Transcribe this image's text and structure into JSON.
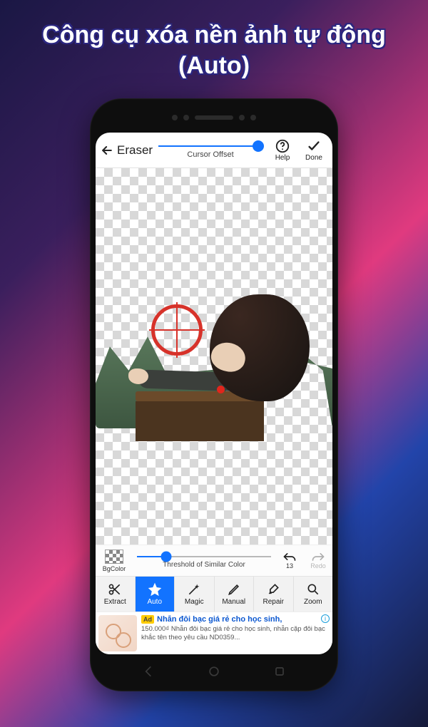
{
  "promo": {
    "title": "Công cụ xóa nền ảnh tự động (Auto)"
  },
  "header": {
    "back_label": "Eraser",
    "cursor_offset_label": "Cursor Offset",
    "help_label": "Help",
    "done_label": "Done"
  },
  "threshold_row": {
    "bgcolor_label": "BgColor",
    "value": "25",
    "label": "Threshold of Similar Color",
    "undo_count": "13",
    "redo_label": "Redo"
  },
  "tools": {
    "extract": "Extract",
    "auto": "Auto",
    "magic": "Magic",
    "manual": "Manual",
    "repair": "Repair",
    "zoom": "Zoom"
  },
  "ad": {
    "badge": "Ad",
    "title": "Nhẫn đôi bạc giá rẻ cho học sinh,",
    "desc": "150.000₫ Nhẫn đôi bạc giá rẻ cho học sinh, nhẫn cặp đôi bạc khắc tên theo yêu cầu ND0359..."
  },
  "colors": {
    "accent": "#1273ff"
  }
}
